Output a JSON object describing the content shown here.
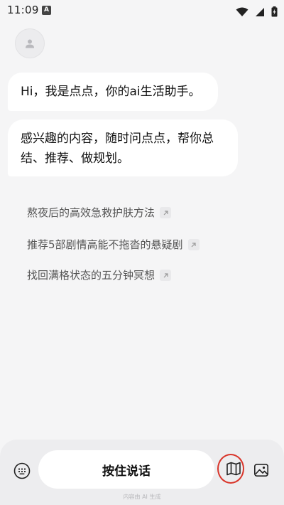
{
  "status_bar": {
    "time": "11:09",
    "notification_icon": "a-letter-icon",
    "icons": [
      "wifi-icon",
      "signal-icon",
      "battery-charging-icon"
    ]
  },
  "chat": {
    "assistant_avatar_icon": "person-icon",
    "messages": [
      "Hi，我是点点，你的ai生活助手。",
      "感兴趣的内容，随时问点点，帮你总结、推荐、做规划。"
    ]
  },
  "suggestions": [
    "熬夜后的高效急救护肤方法",
    "推荐5部剧情高能不拖沓的悬疑剧",
    "找回满格状态的五分钟冥想"
  ],
  "bottom_bar": {
    "hold_to_talk_label": "按住说话",
    "left_icon": "keyboard-icon",
    "map_icon": "map-icon",
    "image_icon": "image-icon",
    "footer_note": "内容由 AI 生成"
  },
  "colors": {
    "background": "#f5f5f6",
    "highlight_circle": "#d9352a"
  }
}
